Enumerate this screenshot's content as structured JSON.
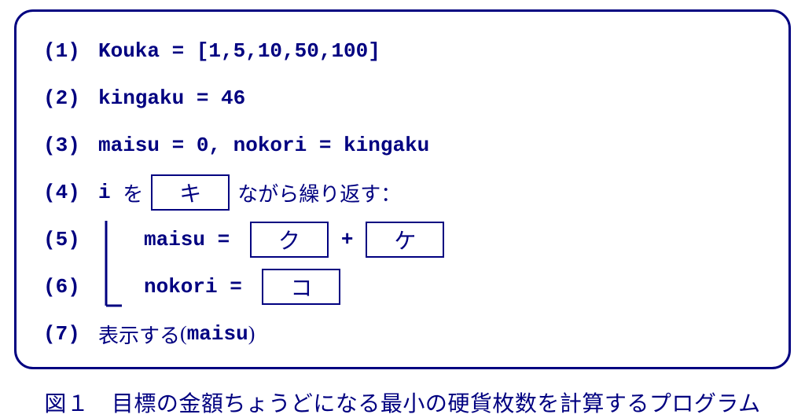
{
  "lines": {
    "l1": {
      "num": "(1)",
      "code": "Kouka = [1,5,10,50,100]"
    },
    "l2": {
      "num": "(2)",
      "code": "kingaku = 46"
    },
    "l3": {
      "num": "(3)",
      "code": "maisu = 0, nokori = kingaku"
    },
    "l4": {
      "num": "(4)",
      "code_pre": "i ",
      "jp_pre": "を",
      "blank": "キ",
      "jp_post": "ながら繰り返す："
    },
    "l5": {
      "num": "(5)",
      "code_pre": "maisu = ",
      "blank1": "ク",
      "plus": "+",
      "blank2": "ケ"
    },
    "l6": {
      "num": "(6)",
      "code_pre": "nokori = ",
      "blank": "コ"
    },
    "l7": {
      "num": "(7)",
      "jp_pre": "表示する",
      "paren_open": "(",
      "code_arg": "maisu",
      "paren_close": ")"
    }
  },
  "caption": "図１　目標の金額ちょうどになる最小の硬貨枚数を計算するプログラム"
}
